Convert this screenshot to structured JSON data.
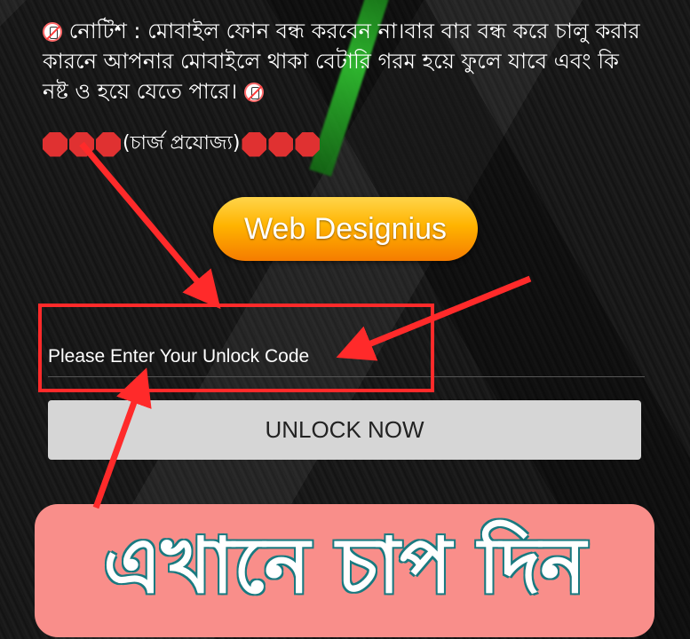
{
  "notice": {
    "text": "নোটিশ : মোবাইল ফোন বন্ধ করবেন না।বার বার বন্ধ করে চালু করার কারনে আপনার মোবাইলে থাকা বেটারি গরম হয়ে ফুলে যাবে এবং কি নষ্ট ও হয়ে যেতে পারে।"
  },
  "charge": {
    "text": "(চার্জ প্রযোজ্য)"
  },
  "logo": {
    "text": "Web Designius"
  },
  "unlock": {
    "label": "Please Enter Your Unlock Code",
    "button": "UNLOCK NOW"
  },
  "banner": {
    "text": "এখানে চাপ দিন"
  },
  "colors": {
    "arrow": "#ff2a2a",
    "button_bg": "#d6d6d6",
    "banner_bg": "#f98e8a",
    "logo_gradient_top": "#ffd54a",
    "logo_gradient_bottom": "#f57c00"
  },
  "icons": [
    "no-mobile-phone-icon",
    "stop-sign-icon"
  ]
}
